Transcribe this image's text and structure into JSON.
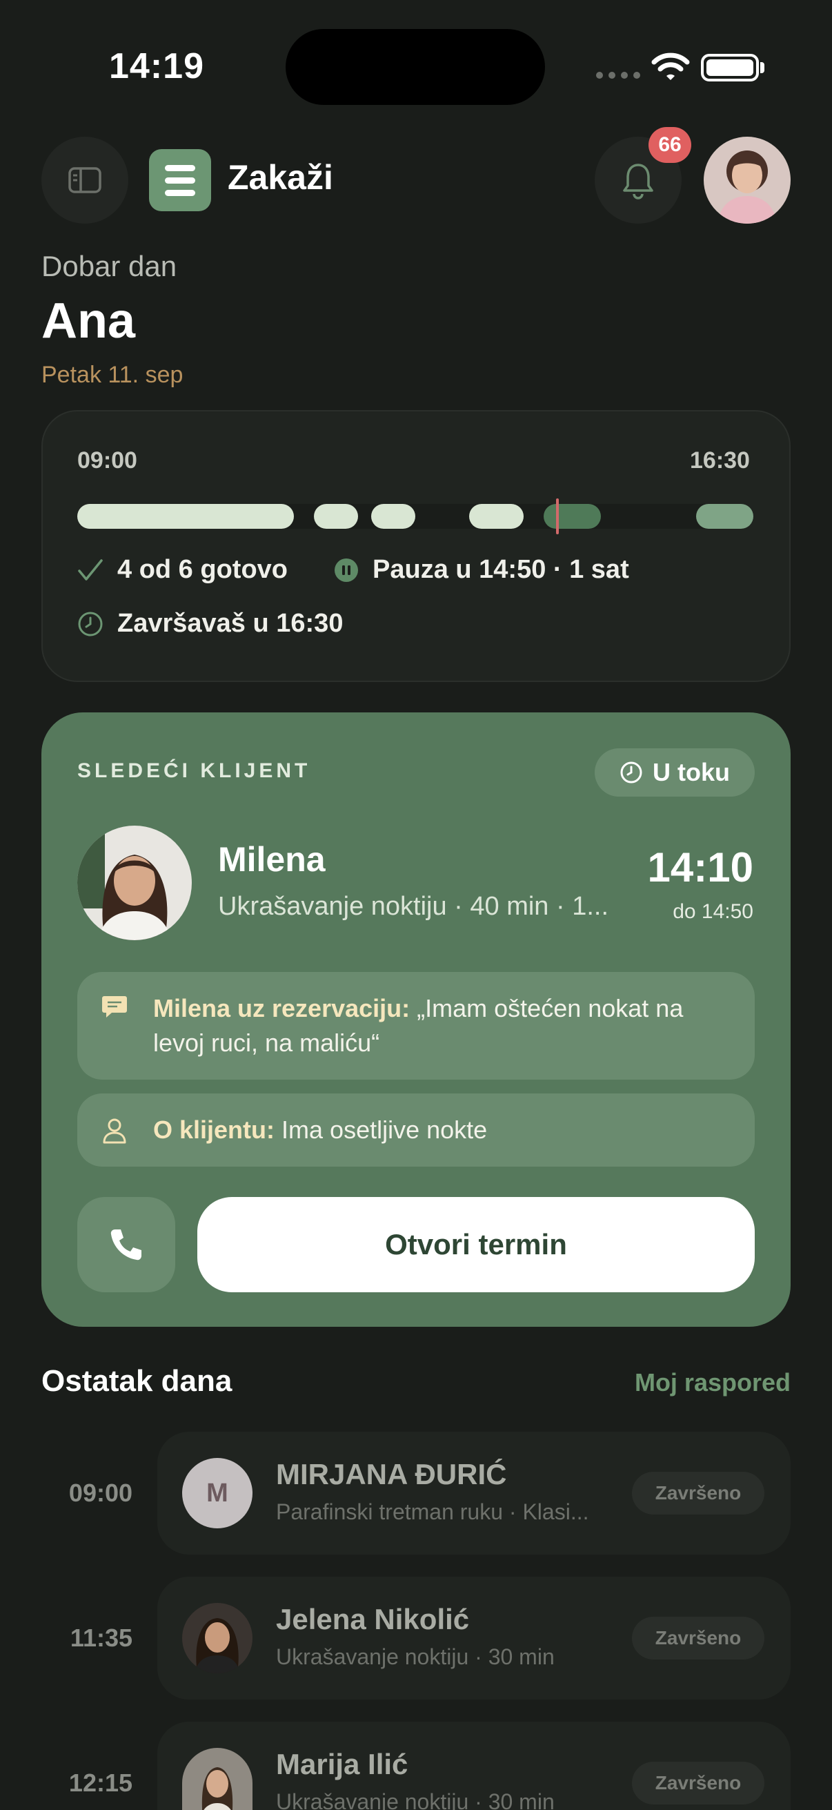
{
  "status_bar": {
    "time": "14:19"
  },
  "header": {
    "app_name": "Zakaži",
    "notification_count": "66"
  },
  "greeting": {
    "hello": "Dobar dan",
    "name": "Ana",
    "date": "Petak 11. sep"
  },
  "day_progress": {
    "start": "09:00",
    "end": "16:30",
    "done": "4 od 6 gotovo",
    "pause": "Pauza u 14:50 · 1 sat",
    "finish": "Završavaš u 16:30",
    "segments": [
      {
        "from": 0.0,
        "to": 0.32,
        "state": "done"
      },
      {
        "from": 0.35,
        "to": 0.415,
        "state": "done"
      },
      {
        "from": 0.435,
        "to": 0.5,
        "state": "done"
      },
      {
        "from": 0.58,
        "to": 0.66,
        "state": "done"
      },
      {
        "from": 0.69,
        "to": 0.775,
        "state": "current"
      },
      {
        "from": 0.915,
        "to": 1.0,
        "state": "upcoming"
      }
    ],
    "now_fraction": 0.708,
    "colors": {
      "done": "#d9e6d3",
      "current": "#4f7a58",
      "upcoming": "#7fa486",
      "now": "#d26a6a"
    }
  },
  "next_client": {
    "label": "SLEDEĆI KLIJENT",
    "status": "U toku",
    "name": "Milena",
    "service": "Ukrašavanje noktiju · 40 min · 1...",
    "time": "14:10",
    "until": "do 14:50",
    "note_label": "Milena uz rezervaciju:",
    "note_text": "„Imam oštećen nokat na levoj ruci, na maliću“",
    "about_label": "O klijentu:",
    "about_text": "Ima osetljive nokte",
    "open_button": "Otvori termin"
  },
  "rest_of_day": {
    "title": "Ostatak dana",
    "link": "Moj raspored",
    "rows": [
      {
        "time": "09:00",
        "name": "MIRJANA ĐURIĆ",
        "service": "Parafinski tretman ruku · Klasi...",
        "status": "Završeno",
        "initial": "M"
      },
      {
        "time": "11:35",
        "name": "Jelena Nikolić",
        "service": "Ukrašavanje noktiju · 30 min",
        "status": "Završeno"
      },
      {
        "time": "12:15",
        "name": "Marija Ilić",
        "service": "Ukrašavanje noktiju · 30 min",
        "status": "Završeno"
      }
    ]
  }
}
